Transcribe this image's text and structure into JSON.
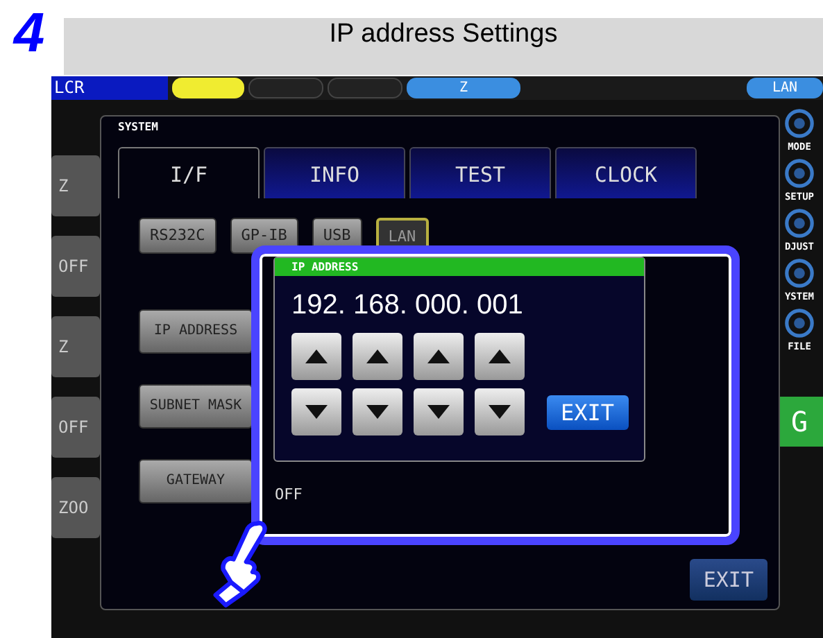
{
  "step": "4",
  "header": {
    "title": "IP address Settings"
  },
  "top_bar": {
    "mode": "LCR",
    "pills": [
      {
        "kind": "yellow"
      },
      {
        "kind": "dark"
      },
      {
        "kind": "dark"
      },
      {
        "kind": "blue",
        "label": "Z"
      }
    ],
    "interface": "LAN"
  },
  "left_buttons": [
    "Z",
    "OFF",
    "Z",
    "OFF",
    "ZOO"
  ],
  "side_menu": [
    {
      "label": "MODE"
    },
    {
      "label": "SETUP"
    },
    {
      "label": "DJUST"
    },
    {
      "label": "YSTEM"
    },
    {
      "label": "FILE"
    }
  ],
  "side_button": "G",
  "system_dialog": {
    "title": "SYSTEM",
    "tabs": [
      {
        "label": "I/F",
        "selected": true
      },
      {
        "label": "INFO",
        "selected": false
      },
      {
        "label": "TEST",
        "selected": false
      },
      {
        "label": "CLOCK",
        "selected": false
      }
    ],
    "interfaces": [
      {
        "label": "RS232C",
        "selected": false
      },
      {
        "label": "GP-IB",
        "selected": false
      },
      {
        "label": "USB",
        "selected": false
      },
      {
        "label": "LAN",
        "selected": true
      }
    ],
    "settings": [
      "IP ADDRESS",
      "SUBNET MASK",
      "GATEWAY"
    ],
    "gateway_value": "OFF",
    "exit": "EXIT"
  },
  "ip_dialog": {
    "title": "IP ADDRESS",
    "value": "192. 168. 000. 001",
    "exit": "EXIT"
  }
}
